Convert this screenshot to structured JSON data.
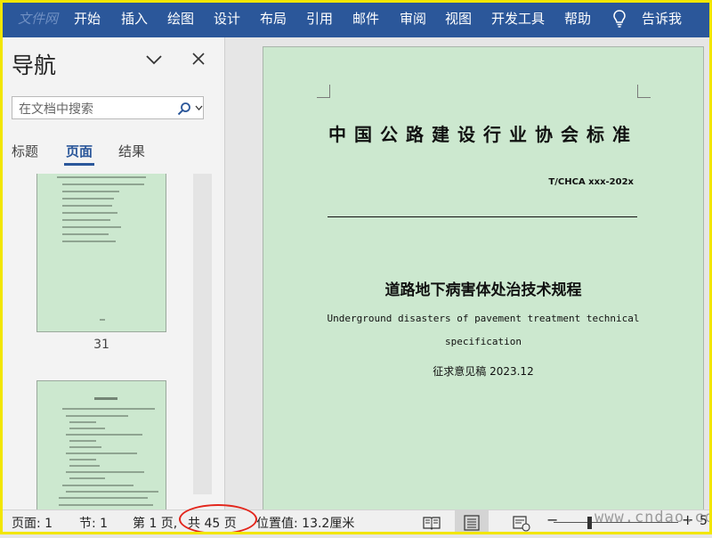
{
  "ribbon": {
    "tabs": [
      "文件",
      "开始",
      "插入",
      "绘图",
      "设计",
      "布局",
      "引用",
      "邮件",
      "审阅",
      "视图",
      "开发工具",
      "帮助"
    ],
    "watermark_suffix": "网",
    "tell_me": "告诉我",
    "bg_color": "#2b579a"
  },
  "nav": {
    "title": "导航",
    "search_placeholder": "在文档中搜索",
    "tabs": [
      "标题",
      "页面",
      "结果"
    ],
    "active_tab": "页面",
    "thumb_page_number": "31"
  },
  "document": {
    "org": "中国公路建设行业协会标准",
    "code": "T/CHCA  xxx-202x",
    "title_zh": "道路地下病害体处治技术规程",
    "title_en_line1": "Underground disasters of pavement treatment technical",
    "title_en_line2": "specification",
    "draft": "征求意见稿 2023.12",
    "page_color": "#cce8cf"
  },
  "status": {
    "page": "页面: 1",
    "section": "节: 1",
    "page_of": "第 1 页,",
    "total": "共 45 页",
    "position": "位置值: 13.2厘米",
    "zoom_edge": "5",
    "highlight_color": "#e3261c"
  },
  "watermark": "www.cndao.com"
}
